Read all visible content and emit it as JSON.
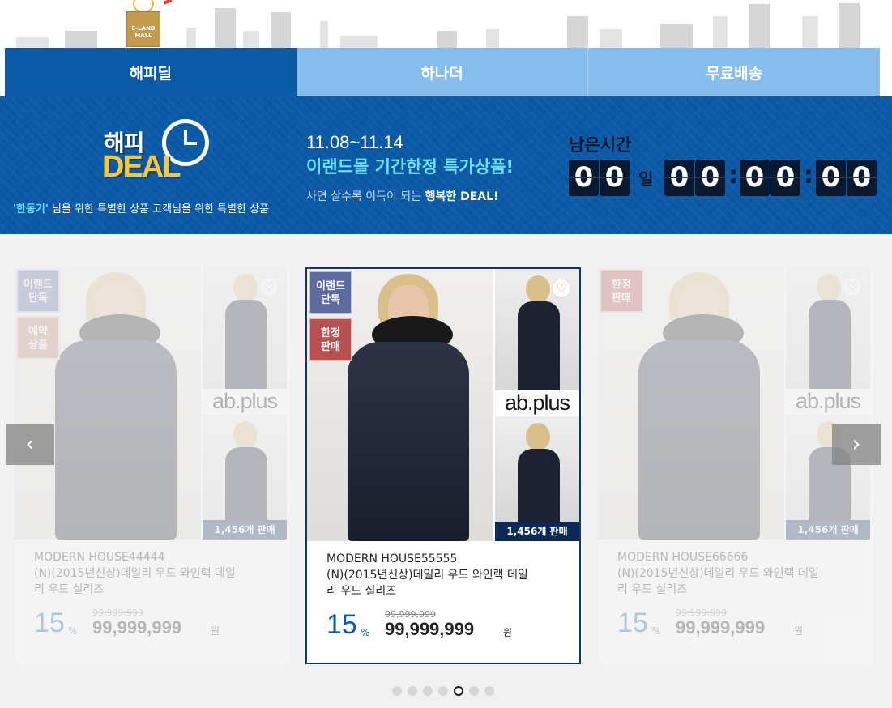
{
  "mascot": {
    "box_text_1": "E-LAND",
    "box_text_2": "MALL"
  },
  "tabs": [
    {
      "label": "해피딜",
      "active": true
    },
    {
      "label": "하나더",
      "active": false
    },
    {
      "label": "무료배송",
      "active": false
    }
  ],
  "banner": {
    "logo_top": "해피",
    "logo_bottom": "DEAL",
    "sub_highlight": "'한동기'",
    "sub_rest": " 님을 위한 특별한 상품 고객님을 위한 특별한 상품",
    "dates": "11.08~11.14",
    "headline": "이랜드몰 기간한정 특가상품!",
    "tagline_prefix": "사면 살수록 이득이 되는 ",
    "tagline_bold": "행복한 DEAL!",
    "timer_label": "남은시간",
    "timer": {
      "day_1": "0",
      "day_2": "0",
      "day_unit": "일",
      "h_1": "0",
      "h_2": "0",
      "m_1": "0",
      "m_2": "0",
      "s_1": "0",
      "s_2": "0",
      "sep": ":"
    }
  },
  "products": [
    {
      "brand_logo": "ab.plus",
      "badges": [
        {
          "text_1": "이랜드",
          "text_2": "단독"
        },
        {
          "text_1": "예약",
          "text_2": "상품"
        }
      ],
      "sold": "1,456개 판매",
      "title": "MODERN HOUSE44444",
      "subtitle_1": "(N)(2015년신상)데일리 우드 와인랙 데일",
      "subtitle_2": "리 우드 실리즈",
      "discount": "15",
      "pct": "%",
      "original_price": "99,999,999",
      "price": "99,999,999",
      "currency": "원"
    },
    {
      "brand_logo": "ab.plus",
      "badges": [
        {
          "text_1": "이랜드",
          "text_2": "단독"
        },
        {
          "text_1": "한정",
          "text_2": "판매"
        }
      ],
      "sold": "1,456개 판매",
      "title": "MODERN HOUSE55555",
      "subtitle_1": "(N)(2015년신상)데일리 우드 와인랙 데일",
      "subtitle_2": "리 우드 실리즈",
      "discount": "15",
      "pct": "%",
      "original_price": "99,999,999",
      "price": "99,999,999",
      "currency": "원"
    },
    {
      "brand_logo": "ab.plus",
      "badges": [
        {
          "text_1": "한정",
          "text_2": "판매"
        }
      ],
      "sold": "1,456개 판매",
      "title": "MODERN HOUSE66666",
      "subtitle_1": "(N)(2015년신상)데일리 우드 와인랙 데일",
      "subtitle_2": "리 우드 실리즈",
      "discount": "15",
      "pct": "%",
      "original_price": "99,999,999",
      "price": "99,999,999",
      "currency": "원"
    }
  ],
  "carousel": {
    "prev_icon": "chevron-left-icon",
    "next_icon": "chevron-right-icon",
    "prev_glyph": "‹",
    "next_glyph": "›",
    "dot_count": 7,
    "active_dot": 5
  },
  "colors": {
    "primary": "#0b5aa8",
    "tab_inactive": "#87bdec",
    "accent_cyan": "#6ee0f5",
    "timer_bg": "#0a1830",
    "sold_bg": "#0c2a55"
  }
}
